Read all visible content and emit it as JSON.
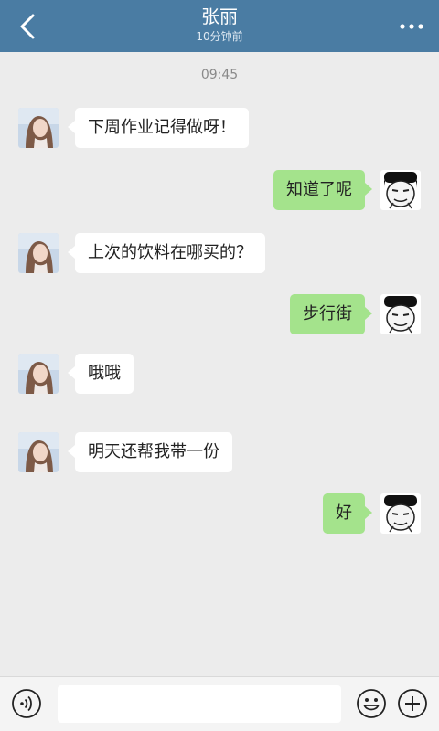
{
  "header": {
    "title": "张丽",
    "subtitle": "10分钟前",
    "back_icon": "back-chevron-icon",
    "more_icon": "more-dots-icon"
  },
  "time_label": "09:45",
  "messages": [
    {
      "side": "left",
      "text": "下周作业记得做呀！"
    },
    {
      "side": "right",
      "text": "知道了呢"
    },
    {
      "side": "left",
      "text": "上次的饮料在哪买的？"
    },
    {
      "side": "right",
      "text": "步行街"
    },
    {
      "side": "left",
      "text": "哦哦"
    },
    {
      "side": "left",
      "text": "明天还帮我带一份"
    },
    {
      "side": "right",
      "text": "好"
    }
  ],
  "input": {
    "value": "",
    "placeholder": ""
  },
  "icons": {
    "voice": "voice-icon",
    "emoji": "emoji-icon",
    "plus": "plus-icon"
  },
  "colors": {
    "header_bg": "#4a7ca3",
    "chat_bg": "#ececec",
    "incoming_bubble": "#ffffff",
    "outgoing_bubble": "#a4e38c"
  }
}
